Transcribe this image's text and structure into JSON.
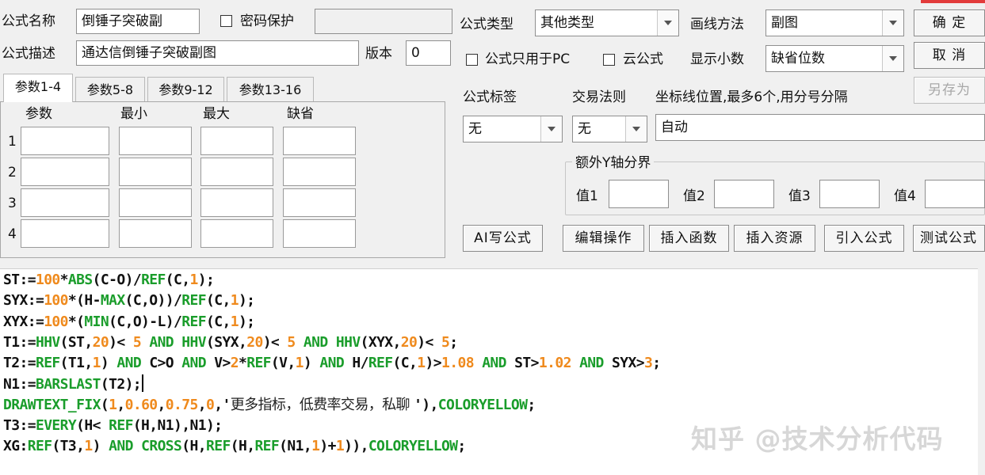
{
  "top": {
    "name_label": "公式名称",
    "name_value": "倒锤子突破副",
    "password_label": "密码保护",
    "password_value": "",
    "desc_label": "公式描述",
    "desc_value": "通达信倒锤子突破副图",
    "version_label": "版本",
    "version_value": "0"
  },
  "right": {
    "type_label": "公式类型",
    "type_value": "其他类型",
    "draw_label": "画线方法",
    "draw_value": "副图",
    "pc_only_label": "公式只用于PC",
    "cloud_label": "云公式",
    "decimals_label": "显示小数",
    "decimals_value": "缺省位数",
    "tag_label": "公式标签",
    "tag_value": "无",
    "trade_label": "交易法则",
    "trade_value": "无",
    "axis_label": "坐标线位置,最多6个,用分号分隔",
    "axis_value": "自动",
    "extra_y_label": "额外Y轴分界",
    "val1": "值1",
    "val2": "值2",
    "val3": "值3",
    "val4": "值4"
  },
  "buttons": {
    "ok": "确 定",
    "cancel": "取 消",
    "save_as": "另存为",
    "ai": "AI写公式",
    "edit": "编辑操作",
    "insert_func": "插入函数",
    "insert_res": "插入资源",
    "import": "引入公式",
    "test": "测试公式"
  },
  "tabs": [
    "参数1-4",
    "参数5-8",
    "参数9-12",
    "参数13-16"
  ],
  "param_headers": [
    "参数",
    "最小",
    "最大",
    "缺省"
  ],
  "param_rows": [
    "1",
    "2",
    "3",
    "4"
  ],
  "code_lines": [
    [
      {
        "t": "ST:="
      },
      {
        "t": "100",
        "c": "n"
      },
      {
        "t": "*"
      },
      {
        "t": "ABS",
        "c": "f"
      },
      {
        "t": "(C-O)/"
      },
      {
        "t": "REF",
        "c": "f"
      },
      {
        "t": "(C,"
      },
      {
        "t": "1",
        "c": "n"
      },
      {
        "t": ");"
      }
    ],
    [
      {
        "t": "SYX:="
      },
      {
        "t": "100",
        "c": "n"
      },
      {
        "t": "*(H-"
      },
      {
        "t": "MAX",
        "c": "f"
      },
      {
        "t": "(C,O))/"
      },
      {
        "t": "REF",
        "c": "f"
      },
      {
        "t": "(C,"
      },
      {
        "t": "1",
        "c": "n"
      },
      {
        "t": ");"
      }
    ],
    [
      {
        "t": "XYX:="
      },
      {
        "t": "100",
        "c": "n"
      },
      {
        "t": "*("
      },
      {
        "t": "MIN",
        "c": "f"
      },
      {
        "t": "(C,O)-L)/"
      },
      {
        "t": "REF",
        "c": "f"
      },
      {
        "t": "(C,"
      },
      {
        "t": "1",
        "c": "n"
      },
      {
        "t": ");"
      }
    ],
    [
      {
        "t": "T1:="
      },
      {
        "t": "HHV",
        "c": "f"
      },
      {
        "t": "(ST,"
      },
      {
        "t": "20",
        "c": "n"
      },
      {
        "t": ")< "
      },
      {
        "t": "5",
        "c": "n"
      },
      {
        "t": " "
      },
      {
        "t": "AND",
        "c": "k"
      },
      {
        "t": " "
      },
      {
        "t": "HHV",
        "c": "f"
      },
      {
        "t": "(SYX,"
      },
      {
        "t": "20",
        "c": "n"
      },
      {
        "t": ")< "
      },
      {
        "t": "5",
        "c": "n"
      },
      {
        "t": " "
      },
      {
        "t": "AND",
        "c": "k"
      },
      {
        "t": " "
      },
      {
        "t": "HHV",
        "c": "f"
      },
      {
        "t": "(XYX,"
      },
      {
        "t": "20",
        "c": "n"
      },
      {
        "t": ")< "
      },
      {
        "t": "5",
        "c": "n"
      },
      {
        "t": ";"
      }
    ],
    [
      {
        "t": "T2:="
      },
      {
        "t": "REF",
        "c": "f"
      },
      {
        "t": "(T1,"
      },
      {
        "t": "1",
        "c": "n"
      },
      {
        "t": ") "
      },
      {
        "t": "AND",
        "c": "k"
      },
      {
        "t": " C>O "
      },
      {
        "t": "AND",
        "c": "k"
      },
      {
        "t": " V>"
      },
      {
        "t": "2",
        "c": "n"
      },
      {
        "t": "*"
      },
      {
        "t": "REF",
        "c": "f"
      },
      {
        "t": "(V,"
      },
      {
        "t": "1",
        "c": "n"
      },
      {
        "t": ") "
      },
      {
        "t": "AND",
        "c": "k"
      },
      {
        "t": " H/"
      },
      {
        "t": "REF",
        "c": "f"
      },
      {
        "t": "(C,"
      },
      {
        "t": "1",
        "c": "n"
      },
      {
        "t": ")>"
      },
      {
        "t": "1.08",
        "c": "n"
      },
      {
        "t": " "
      },
      {
        "t": "AND",
        "c": "k"
      },
      {
        "t": " ST>"
      },
      {
        "t": "1.02",
        "c": "n"
      },
      {
        "t": " "
      },
      {
        "t": "AND",
        "c": "k"
      },
      {
        "t": " SYX>"
      },
      {
        "t": "3",
        "c": "n"
      },
      {
        "t": ";"
      }
    ],
    [
      {
        "t": "N1:="
      },
      {
        "t": "BARSLAST",
        "c": "f"
      },
      {
        "t": "(T2);"
      },
      {
        "caret": true
      }
    ],
    [
      {
        "t": "DRAWTEXT_FIX",
        "c": "f"
      },
      {
        "t": "("
      },
      {
        "t": "1",
        "c": "n"
      },
      {
        "t": ","
      },
      {
        "t": "0.60",
        "c": "n"
      },
      {
        "t": ","
      },
      {
        "t": "0.75",
        "c": "n"
      },
      {
        "t": ","
      },
      {
        "t": "0",
        "c": "n"
      },
      {
        "t": ",'"
      },
      {
        "t": "更多指标，低费率交易，私聊 ",
        "c": "s"
      },
      {
        "t": "'),"
      },
      {
        "t": "COLORYELLOW",
        "c": "f"
      },
      {
        "t": ";"
      }
    ],
    [
      {
        "t": "T3:="
      },
      {
        "t": "EVERY",
        "c": "f"
      },
      {
        "t": "(H< "
      },
      {
        "t": "REF",
        "c": "f"
      },
      {
        "t": "(H,N1),N1);"
      }
    ],
    [
      {
        "t": "XG:"
      },
      {
        "t": "REF",
        "c": "f"
      },
      {
        "t": "(T3,"
      },
      {
        "t": "1",
        "c": "n"
      },
      {
        "t": ") "
      },
      {
        "t": "AND",
        "c": "k"
      },
      {
        "t": " "
      },
      {
        "t": "CROSS",
        "c": "f"
      },
      {
        "t": "(H,"
      },
      {
        "t": "REF",
        "c": "f"
      },
      {
        "t": "(H,"
      },
      {
        "t": "REF",
        "c": "f"
      },
      {
        "t": "(N1,"
      },
      {
        "t": "1",
        "c": "n"
      },
      {
        "t": ")+"
      },
      {
        "t": "1",
        "c": "n"
      },
      {
        "t": ")),"
      },
      {
        "t": "COLORYELLOW",
        "c": "f"
      },
      {
        "t": ";"
      }
    ]
  ],
  "watermark": "知乎 @技术分析代码"
}
